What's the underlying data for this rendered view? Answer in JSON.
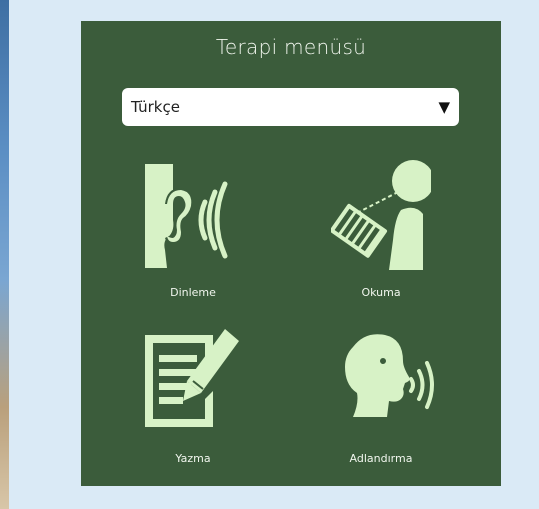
{
  "menu": {
    "title": "Terapi menüsü",
    "language_select": {
      "value": "Türkçe",
      "arrow": "▼"
    },
    "items": [
      {
        "label": "Dinleme",
        "icon": "listening-ear-icon"
      },
      {
        "label": "Okuma",
        "icon": "reading-person-icon"
      },
      {
        "label": "Yazma",
        "icon": "writing-notepad-icon"
      },
      {
        "label": "Adlandırma",
        "icon": "speaking-head-icon"
      }
    ]
  },
  "colors": {
    "panel": "#3b5c3b",
    "icon": "#d7f2c6",
    "text": "#f1f6ee",
    "background": "#daeaf6"
  }
}
